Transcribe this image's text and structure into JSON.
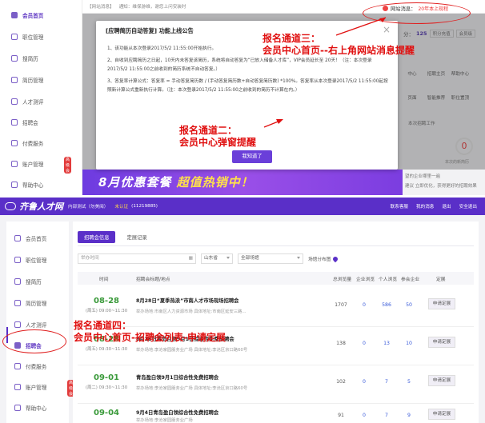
{
  "top": {
    "sidebar": [
      {
        "label": "会员首页",
        "active": true
      },
      {
        "label": "职位管理"
      },
      {
        "label": "搜简历"
      },
      {
        "label": "简历管理"
      },
      {
        "label": "人才测评"
      },
      {
        "label": "招聘会"
      },
      {
        "label": "付费服务"
      },
      {
        "label": "账户管理",
        "badge": "高级会"
      },
      {
        "label": "帮助中心"
      }
    ],
    "notice": {
      "tag": "【网站消息】",
      "text": "通知：维保游维，谢您上问安装时"
    },
    "site_msg": {
      "label": "网站消息：",
      "value": "20年本上现程"
    },
    "right_info": {
      "points_label": "分：",
      "points": "125",
      "btn1": "积分充值",
      "btn2": "会员级"
    },
    "right_icons": [
      "中心",
      "招聘主页",
      "帮助中心",
      "页面",
      "智能推荐",
      "职位置顶"
    ],
    "right_status": "本次招聘工作",
    "zero_value": "0",
    "zero_label": "本次的新简历",
    "right_bottom": [
      "望的企业哪里一遍",
      "建议 立即优化，获得更好的招聘效果"
    ],
    "modal": {
      "title": "[应聘简历自动答复] 功能上线公告",
      "close": "×",
      "p1": "1、该功能从本次登录2017/5/2 11:55:00开始执行。",
      "p2": "2、自收到应聘简历之日起，10天内未答复该简历，系统将自动答复为“已放入储备人才库”，VIP会员延长至 20天！（注：本次登录2017/5/2 11:55:00之前收到的简历系统不自动答复。）",
      "p3": "3、答复率计算公式：答复率 = 手动答复简历数 / (手动答复简历数+自动答复简历数) *100%。答复率从本次登录2017/5/2 11:55:00起按照新计算公式重新执行计算。（注：本次登录2017/5/2 11:55:00之前收到的简历不计算在内。）",
      "button": "我知道了"
    },
    "banner": {
      "part1": "8月优惠套餐 ",
      "part2": "超值热销中！"
    },
    "annotations": {
      "a3_line1": "报名通道三：",
      "a3_line2": "会员中心首页--右上角网站消息提醒",
      "a2_line1": "报名通道二：",
      "a2_line2": "会员中心弹窗提醒"
    }
  },
  "bottom": {
    "header": {
      "logo": "齐鲁人才网",
      "sub": "内部测试（勿美阅）",
      "uncertified": "未认证",
      "account": "(11219885)",
      "links": [
        "联系客服",
        "我的消息",
        "退出",
        "安全退出"
      ]
    },
    "sidebar": [
      {
        "label": "会员首页"
      },
      {
        "label": "职位管理"
      },
      {
        "label": "搜简历"
      },
      {
        "label": "简历管理"
      },
      {
        "label": "人才测评"
      },
      {
        "label": "招聘会",
        "active": true
      },
      {
        "label": "付费服务"
      },
      {
        "label": "账户管理",
        "badge": "高级会"
      },
      {
        "label": "帮助中心"
      }
    ],
    "tabs": [
      "招聘会信息",
      "定展记录"
    ],
    "filters": {
      "time_placeholder": "举办时间",
      "province": "山东省",
      "venue": "全部场馆",
      "map": "场馆分布图"
    },
    "columns": [
      "时间",
      "招聘会标题/地点",
      "总浏览量",
      "企业浏览",
      "个人浏览",
      "参会企业",
      "定展"
    ],
    "rows": [
      {
        "date": "08-28",
        "week": "(周五) 09:00~11:30",
        "title": "8月28日“夏季热浪”市南人才市场现场招聘会",
        "place": "举办场地:市南区人力资源市场  具体地址:市南区延安三路...",
        "views": "1707",
        "company_views": "0",
        "person_views": "586",
        "companies": "50",
        "action": "申请定展"
      },
      {
        "date": "08-28",
        "week": "(周五) 09:30~11:30",
        "title": "8月28日青岛白领9月1日综合性免费招聘会",
        "place": "举办场地:李沧家园服务业广场  具体地址:李沧区京口路60号",
        "views": "138",
        "company_views": "0",
        "person_views": "13",
        "companies": "10",
        "action": "申请定展"
      },
      {
        "date": "09-01",
        "week": "(周二) 09:30~11:30",
        "title": "青岛盈白领9月1日综合性免费招聘会",
        "place": "举办场地:李沧家园服务业广场  具体地址:李沧区京口路60号",
        "views": "102",
        "company_views": "0",
        "person_views": "7",
        "companies": "5",
        "action": "申请定展"
      },
      {
        "date": "09-04",
        "week": "",
        "title": "9月4日青岛盈白领综合性免费招聘会",
        "place": "举办场地:李沧家园服务业广场",
        "views": "91",
        "company_views": "0",
        "person_views": "7",
        "companies": "9",
        "action": "申请定展"
      }
    ],
    "annotations": {
      "a4_line1": "报名通道四：",
      "a4_line2": "会员中心首页-招聘会列表-申请定展"
    }
  }
}
